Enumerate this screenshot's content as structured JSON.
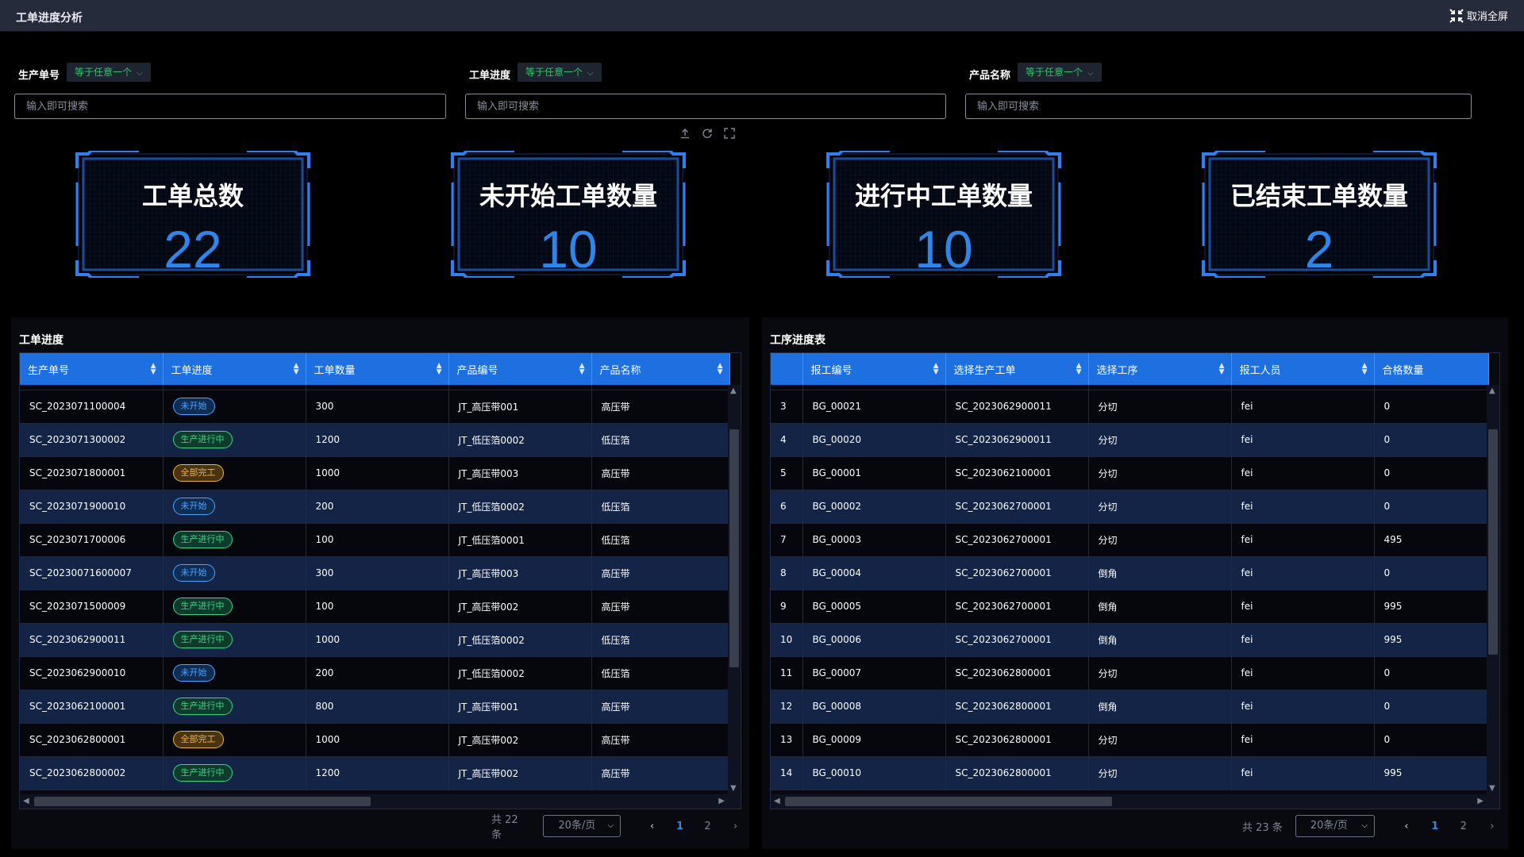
{
  "header": {
    "title": "工单进度分析",
    "exit_fullscreen": "取消全屏"
  },
  "filters": [
    {
      "label": "生产单号",
      "mode": "等于任意一个",
      "placeholder": "输入即可搜索"
    },
    {
      "label": "工单进度",
      "mode": "等于任意一个",
      "placeholder": "输入即可搜索"
    },
    {
      "label": "产品名称",
      "mode": "等于任意一个",
      "placeholder": "输入即可搜索"
    }
  ],
  "kpis": [
    {
      "title": "工单总数",
      "value": "22"
    },
    {
      "title": "未开始工单数量",
      "value": "10"
    },
    {
      "title": "进行中工单数量",
      "value": "10"
    },
    {
      "title": "已结束工单数量",
      "value": "2"
    }
  ],
  "left_table": {
    "title": "工单进度",
    "columns": [
      "生产单号",
      "工单进度",
      "工单数量",
      "产品编号",
      "产品名称"
    ],
    "rows": [
      [
        "SC_2023071100004",
        "未开始",
        "300",
        "JT_高压带001",
        "高压带"
      ],
      [
        "SC_2023071300002",
        "生产进行中",
        "1200",
        "JT_低压箔0002",
        "低压箔"
      ],
      [
        "SC_2023071800001",
        "全部完工",
        "1000",
        "JT_高压带003",
        "高压带"
      ],
      [
        "SC_2023071900010",
        "未开始",
        "200",
        "JT_低压箔0002",
        "低压箔"
      ],
      [
        "SC_2023071700006",
        "生产进行中",
        "100",
        "JT_低压箔0001",
        "低压箔"
      ],
      [
        "SC_20230071600007",
        "未开始",
        "300",
        "JT_高压带003",
        "高压带"
      ],
      [
        "SC_2023071500009",
        "生产进行中",
        "100",
        "JT_高压带002",
        "高压带"
      ],
      [
        "SC_2023062900011",
        "生产进行中",
        "1000",
        "JT_低压箔0002",
        "低压箔"
      ],
      [
        "SC_2023062900010",
        "未开始",
        "200",
        "JT_低压箔0002",
        "低压箔"
      ],
      [
        "SC_2023062100001",
        "生产进行中",
        "800",
        "JT_高压带001",
        "高压带"
      ],
      [
        "SC_2023062800001",
        "全部完工",
        "1000",
        "JT_高压带002",
        "高压带"
      ],
      [
        "SC_2023062800002",
        "生产进行中",
        "1200",
        "JT_高压带002",
        "高压带"
      ]
    ],
    "pager": {
      "total": "共 22 条",
      "size": "20条/页",
      "prev": "‹",
      "pages": [
        "1",
        "2"
      ],
      "next": "›"
    }
  },
  "right_table": {
    "title": "工序进度表",
    "columns": [
      "",
      "报工编号",
      "选择生产工单",
      "选择工序",
      "报工人员",
      "合格数量"
    ],
    "rows": [
      [
        "3",
        "BG_00021",
        "SC_2023062900011",
        "分切",
        "fei",
        "0"
      ],
      [
        "4",
        "BG_00020",
        "SC_2023062900011",
        "分切",
        "fei",
        "0"
      ],
      [
        "5",
        "BG_00001",
        "SC_2023062100001",
        "分切",
        "fei",
        "0"
      ],
      [
        "6",
        "BG_00002",
        "SC_2023062700001",
        "分切",
        "fei",
        "0"
      ],
      [
        "7",
        "BG_00003",
        "SC_2023062700001",
        "分切",
        "fei",
        "495"
      ],
      [
        "8",
        "BG_00004",
        "SC_2023062700001",
        "倒角",
        "fei",
        "0"
      ],
      [
        "9",
        "BG_00005",
        "SC_2023062700001",
        "倒角",
        "fei",
        "995"
      ],
      [
        "10",
        "BG_00006",
        "SC_2023062700001",
        "倒角",
        "fei",
        "995"
      ],
      [
        "11",
        "BG_00007",
        "SC_2023062800001",
        "分切",
        "fei",
        "0"
      ],
      [
        "12",
        "BG_00008",
        "SC_2023062800001",
        "倒角",
        "fei",
        "0"
      ],
      [
        "13",
        "BG_00009",
        "SC_2023062800001",
        "分切",
        "fei",
        "0"
      ],
      [
        "14",
        "BG_00010",
        "SC_2023062800001",
        "分切",
        "fei",
        "995"
      ]
    ],
    "pager": {
      "total": "共 23 条",
      "size": "20条/页",
      "prev": "‹",
      "pages": [
        "1",
        "2"
      ],
      "next": "›"
    }
  },
  "icons": {
    "exit_fullscreen": "compress-icon",
    "export": "upload-icon",
    "refresh": "refresh-icon",
    "fullscreen": "expand-icon"
  },
  "colors": {
    "accent": "#1e6fe0",
    "kpi_value": "#2f86e8",
    "status_not_started": "#4ea3ff",
    "status_running": "#3ed48a",
    "status_done": "#f0b24a",
    "filter_mode": "#35c46f"
  }
}
